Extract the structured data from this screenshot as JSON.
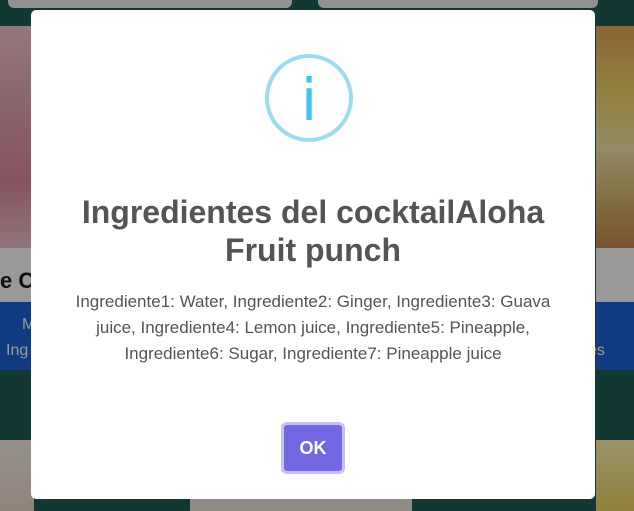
{
  "background": {
    "card_title_fragment": "e Co",
    "left_band_text": [
      "M",
      "Ing"
    ],
    "right_band_text": "es"
  },
  "modal": {
    "icon": "info-icon",
    "icon_glyph": "i",
    "title": "Ingredientes del cocktailAloha Fruit punch",
    "text": "Ingrediente1: Water, Ingrediente2: Ginger, Ingrediente3: Guava juice, Ingrediente4: Lemon juice, Ingrediente5: Pineapple, Ingrediente6: Sugar, Ingrediente7: Pineapple juice",
    "confirm_label": "OK"
  },
  "colors": {
    "icon_ring": "#9bdcef",
    "icon_glyph": "#3fc3ee",
    "confirm_button": "#7367e2",
    "blue_band": "#1d62d6",
    "page_background": "#1f5e57"
  }
}
